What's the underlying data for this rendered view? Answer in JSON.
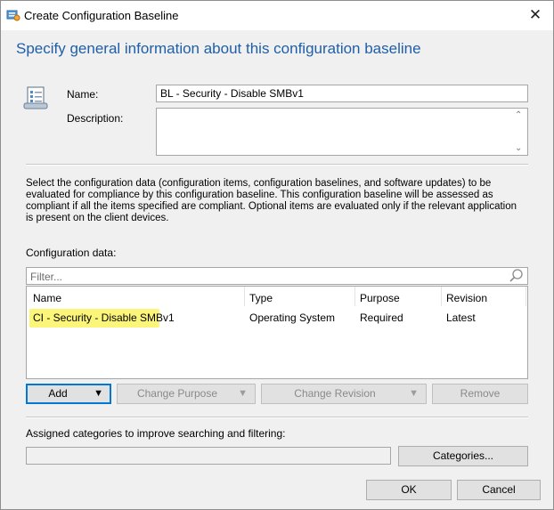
{
  "window": {
    "title": "Create Configuration Baseline",
    "close_glyph": "✕",
    "heading": "Specify general information about this configuration baseline"
  },
  "form": {
    "name_label": "Name:",
    "name_value": "BL - Security - Disable SMBv1",
    "description_label": "Description:",
    "description_value": ""
  },
  "info_text": "Select the configuration data (configuration items, configuration baselines, and software updates) to be evaluated for compliance by this configuration baseline. This configuration baseline will be assessed as compliant if all the items specified are compliant. Optional items are evaluated only if the relevant application is present on  the client devices.",
  "config_data": {
    "label": "Configuration data:",
    "filter_placeholder": "Filter...",
    "columns": [
      "Name",
      "Type",
      "Purpose",
      "Revision"
    ],
    "rows": [
      {
        "name": "CI - Security - Disable SMBv1",
        "type": "Operating System",
        "purpose": "Required",
        "revision": "Latest",
        "highlight_color": "#fbf57a"
      }
    ]
  },
  "buttons": {
    "add": "Add",
    "change_purpose": "Change Purpose",
    "change_revision": "Change Revision",
    "remove": "Remove",
    "categories": "Categories...",
    "ok": "OK",
    "cancel": "Cancel"
  },
  "categories": {
    "label": "Assigned categories to improve searching and filtering:",
    "value": ""
  },
  "icons": {
    "title": "baseline-app-icon",
    "baseline": "configuration-baseline-icon",
    "filter": "search-icon",
    "dropdown": "triangle-down-icon",
    "scroll_up": "scroll-up-arrow-icon",
    "scroll_down": "scroll-down-arrow-icon"
  },
  "colors": {
    "heading": "#1f5fa8",
    "highlight": "#fbf57a",
    "primary_border": "#0078d7"
  }
}
